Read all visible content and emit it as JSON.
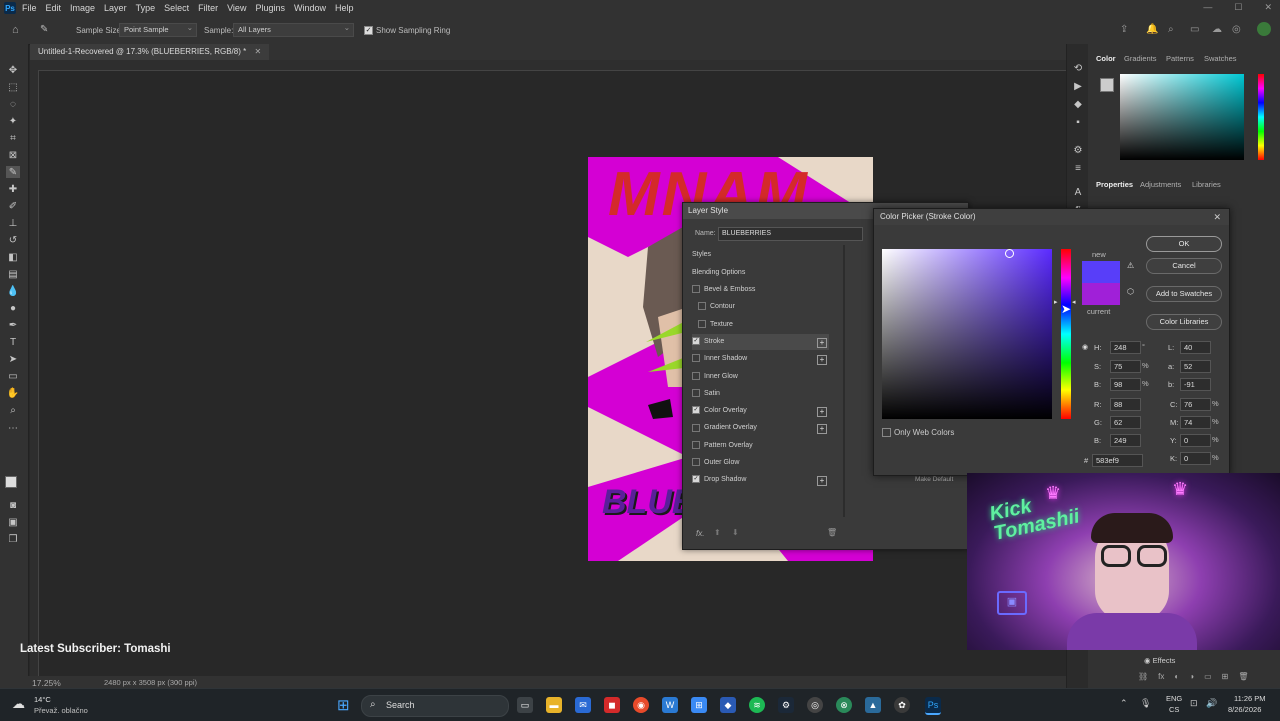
{
  "app": {
    "logo": "Ps",
    "menu": [
      "File",
      "Edit",
      "Image",
      "Layer",
      "Type",
      "Select",
      "Filter",
      "View",
      "Plugins",
      "Window",
      "Help"
    ]
  },
  "options_bar": {
    "sample_size_label": "Sample Size:",
    "sample_size_value": "Point Sample",
    "sample_label": "Sample:",
    "sample_value": "All Layers",
    "show_sampling_ring": "Show Sampling Ring"
  },
  "document": {
    "tab_title": "Untitled-1-Recovered @ 17.3% (BLUEBERRIES, RGB/8) *",
    "zoom": "17.25%",
    "doc_info": "2480 px x 3508 px (300 ppi)",
    "canvas_text_top": "MNAM",
    "canvas_text_bottom": "BLUE"
  },
  "right_panel": {
    "color_tabs": [
      "Color",
      "Gradients",
      "Patterns",
      "Swatches"
    ],
    "properties_tabs": [
      "Properties",
      "Adjustments",
      "Libraries"
    ],
    "effects_label": "Effects"
  },
  "layer_style": {
    "title": "Layer Style",
    "name_label": "Name:",
    "name_value": "BLUEBERRIES",
    "styles_header": "Styles",
    "blending_options": "Blending Options",
    "items": [
      {
        "label": "Bevel & Emboss",
        "checked": false,
        "plus": false,
        "indent": false
      },
      {
        "label": "Contour",
        "checked": false,
        "plus": false,
        "indent": true
      },
      {
        "label": "Texture",
        "checked": false,
        "plus": false,
        "indent": true
      },
      {
        "label": "Stroke",
        "checked": true,
        "plus": true,
        "indent": false
      },
      {
        "label": "Inner Shadow",
        "checked": false,
        "plus": true,
        "indent": false
      },
      {
        "label": "Inner Glow",
        "checked": false,
        "plus": false,
        "indent": false
      },
      {
        "label": "Satin",
        "checked": false,
        "plus": false,
        "indent": false
      },
      {
        "label": "Color Overlay",
        "checked": true,
        "plus": true,
        "indent": false
      },
      {
        "label": "Gradient Overlay",
        "checked": false,
        "plus": true,
        "indent": false
      },
      {
        "label": "Pattern Overlay",
        "checked": false,
        "plus": false,
        "indent": false
      },
      {
        "label": "Outer Glow",
        "checked": false,
        "plus": false,
        "indent": false
      },
      {
        "label": "Drop Shadow",
        "checked": true,
        "plus": true,
        "indent": false
      }
    ],
    "make_default": "Make Default",
    "fx_label": "fx."
  },
  "color_picker": {
    "title": "Color Picker (Stroke Color)",
    "ok": "OK",
    "cancel": "Cancel",
    "add_to_swatches": "Add to Swatches",
    "color_libraries": "Color Libraries",
    "new_label": "new",
    "current_label": "current",
    "new_color": "#583ef9",
    "current_color": "#a020d8",
    "only_web_colors": "Only Web Colors",
    "fields": {
      "H": "248",
      "S": "75",
      "B": "98",
      "R": "88",
      "G": "62",
      "Bb": "249",
      "L": "40",
      "a": "52",
      "b": "-91",
      "C": "76",
      "M": "74",
      "Y": "0",
      "K": "0"
    },
    "units": {
      "H": "°",
      "S": "%",
      "B": "%",
      "C": "%",
      "M": "%",
      "Y": "%",
      "K": "%"
    },
    "hex_label": "#",
    "hex": "583ef9"
  },
  "stream": {
    "subscriber": "Latest Subscriber: Tomashi",
    "webcam_sign": "Kick Tomashii"
  },
  "taskbar": {
    "weather_temp": "14°C",
    "weather_desc": "Převaž. oblačno",
    "search": "Search",
    "lang_top": "ENG",
    "lang_bottom": "CS",
    "time": "11:26 PM",
    "date": "8/26/2026"
  }
}
